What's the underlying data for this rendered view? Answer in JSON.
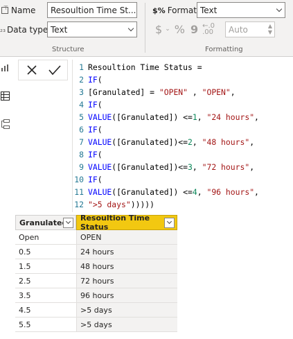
{
  "ribbon": {
    "name_label": "Name",
    "name_value": "Resoultion Time St...",
    "datatype_label": "Data type",
    "datatype_value": "Text",
    "format_label": "Format",
    "format_value": "Text",
    "currency_symbol": "$",
    "percent_symbol": "%",
    "comma_symbol": "9",
    "decimals_value": "Auto",
    "structure_group": "Structure",
    "formatting_group": "Formatting"
  },
  "editor": {
    "lines": [
      {
        "n": "1",
        "text": "Resoultion Time Status ="
      },
      {
        "n": "2",
        "text": "IF("
      },
      {
        "n": "3",
        "text": "[Granulated] = \"OPEN\" , \"OPEN\","
      },
      {
        "n": "4",
        "text": "IF("
      },
      {
        "n": "5",
        "text": "VALUE([Granulated]) <=1, \"24 hours\","
      },
      {
        "n": "6",
        "text": "IF("
      },
      {
        "n": "7",
        "text": "VALUE([Granulated])<=2, \"48 hours\","
      },
      {
        "n": "8",
        "text": "IF("
      },
      {
        "n": "9",
        "text": "VALUE([Granulated])<=3, \"72 hours\","
      },
      {
        "n": "10",
        "text": "IF("
      },
      {
        "n": "11",
        "text": "VALUE([Granulated]) <=4, \"96 hours\","
      },
      {
        "n": "12",
        "text": "\">5 days\")))))"
      }
    ]
  },
  "table": {
    "columns": [
      "Granulated",
      "Resoultion Time Status"
    ],
    "rows": [
      [
        "Open",
        "OPEN"
      ],
      [
        "0.5",
        "24 hours"
      ],
      [
        "1.5",
        "48 hours"
      ],
      [
        "2.5",
        "72 hours"
      ],
      [
        "3.5",
        "96 hours"
      ],
      [
        "4.5",
        ">5 days"
      ],
      [
        "5.5",
        ">5 days"
      ]
    ]
  },
  "colors": {
    "accent_header": "#f2c811",
    "keyword": "#0000ff",
    "string": "#a31515",
    "number": "#098658",
    "line_number": "#237893"
  }
}
